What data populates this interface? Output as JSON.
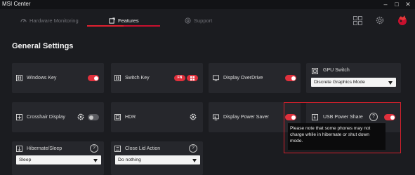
{
  "window": {
    "title": "MSI Center"
  },
  "nav": {
    "tabs": [
      {
        "label": "Hardware Monitoring",
        "icon": "gauge-icon",
        "active": false
      },
      {
        "label": "Features",
        "icon": "features-icon",
        "active": true
      },
      {
        "label": "Support",
        "icon": "support-icon",
        "active": false
      }
    ],
    "right_icons": [
      "grid-icon",
      "settings-icon",
      "dragon-logo-icon"
    ]
  },
  "section": {
    "title": "General Settings"
  },
  "cards": {
    "windows_key": {
      "label": "Windows Key",
      "icon": "windows-key-icon",
      "toggle": true
    },
    "switch_key": {
      "label": "Switch Key",
      "icon": "switch-key-icon",
      "badge": "FN"
    },
    "display_overdrive": {
      "label": "Display OverDrive",
      "icon": "display-overdrive-icon",
      "toggle": true
    },
    "gpu_switch": {
      "label": "GPU Switch",
      "icon": "gpu-switch-icon",
      "select": "Discrete Graphics Mode"
    },
    "crosshair": {
      "label": "Crosshair Display",
      "icon": "crosshair-icon",
      "toggle": false
    },
    "hdr": {
      "label": "HDR",
      "icon": "hdr-icon"
    },
    "display_power_saver": {
      "label": "Display Power Saver",
      "icon": "power-saver-icon",
      "toggle": true
    },
    "usb_power_share": {
      "label": "USB Power Share",
      "icon": "usb-icon",
      "toggle": true
    },
    "hibernate_sleep": {
      "label": "Hibernate/Sleep",
      "icon": "hibernate-icon",
      "select": "Sleep"
    },
    "close_lid": {
      "label": "Close Lid Action",
      "icon": "lid-icon",
      "select": "Do nothing"
    }
  },
  "tooltip": {
    "text": "Please note that some phones may not charge while in hibernate or shut down mode."
  },
  "colors": {
    "accent": "#e0303c",
    "background": "#1b1c20",
    "card": "#26272c"
  }
}
